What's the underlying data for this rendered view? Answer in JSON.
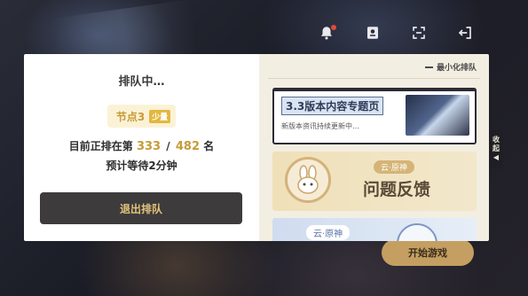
{
  "queue": {
    "title": "排队中…",
    "node_label": "节点3",
    "load_tag": "少量",
    "position_prefix": "目前正排在第",
    "position": "333",
    "total": "482",
    "position_suffix": "名",
    "wait_text": "预计等待2分钟",
    "exit_label": "退出排队"
  },
  "right_panel": {
    "minimize_label": "最小化排队",
    "cards": [
      {
        "title": "3.3版本内容专题页",
        "subtitle": "新版本资讯持续更新中…"
      },
      {
        "brand": "云·原神",
        "title": "问题反馈"
      },
      {
        "brand": "云·原神"
      }
    ]
  },
  "side_tab": {
    "label_top": "收",
    "label_bottom": "起",
    "arrow": "◀"
  },
  "start_button": {
    "label": "开始游戏"
  },
  "icons": [
    "bell-icon",
    "profile-card-icon",
    "scan-frame-icon",
    "exit-icon",
    "bunny-mascot-icon"
  ],
  "colors": {
    "accent_gold": "#c79b38",
    "dark_button": "#3d3b3c",
    "button_text": "#e2c27b"
  }
}
